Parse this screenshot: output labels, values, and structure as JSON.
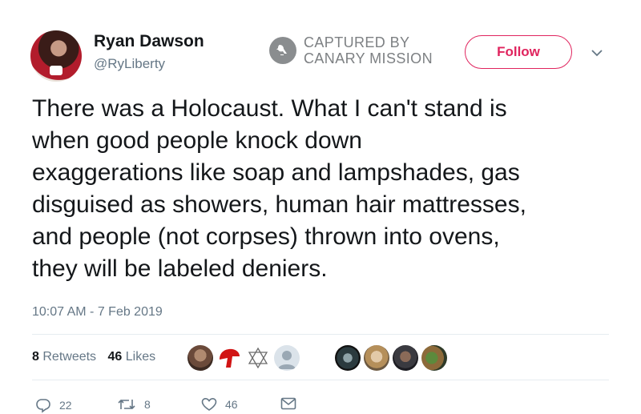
{
  "user": {
    "name": "Ryan Dawson",
    "handle": "@RyLiberty"
  },
  "watermark": {
    "line1": "CAPTURED BY",
    "line2": "CANARY MISSION",
    "icon": "canary-bird-icon"
  },
  "follow_label": "Follow",
  "tweet": {
    "lines": [
      "There was a Holocaust. What I can't stand is",
      "when good people knock down",
      "exaggerations like soap and lampshades, gas",
      "disguised as showers, human hair mattresses,",
      "and people (not corpses) thrown into ovens,",
      "they will be labeled deniers."
    ],
    "timestamp": "10:07 AM - 7 Feb 2019"
  },
  "stats": {
    "retweets_count": "8",
    "retweets_label": "Retweets",
    "likes_count": "46",
    "likes_label": "Likes"
  },
  "actions": {
    "reply_count": "22",
    "retweet_count": "8",
    "like_count": "46"
  },
  "colors": {
    "follow_accent": "#e0245e",
    "secondary_text": "#657786",
    "divider": "#e6ecf0"
  }
}
